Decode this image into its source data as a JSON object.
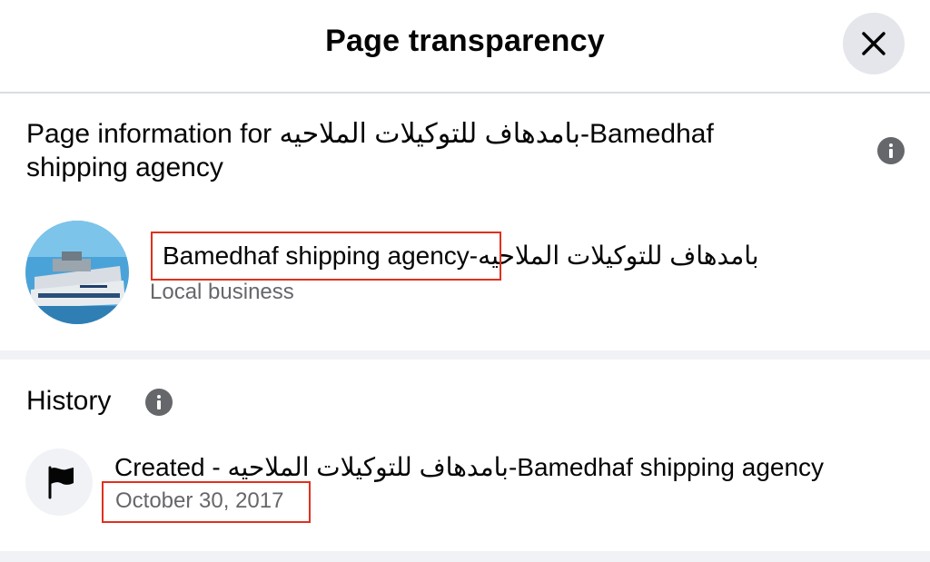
{
  "dialog": {
    "title": "Page transparency",
    "close_icon": "close-icon"
  },
  "page_info": {
    "title": "Page information for بامدهاف للتوكيلات الملاحيه-Bamedhaf shipping agency",
    "page_name": "بامدهاف للتوكيلات الملاحيه-Bamedhaf shipping agency",
    "page_name_latin": "Bamedhaf shipping agency-",
    "page_name_arabic": "بامدهاف للتوكيلات الملاحيه",
    "category": "Local business",
    "info_icon": "info-icon"
  },
  "history": {
    "title": "History",
    "info_icon": "info-icon",
    "entry_prefix": "Created - ",
    "entry_name": "بامدهاف للتوكيلات الملاحيه-Bamedhaf shipping agency",
    "date": "October 30, 2017",
    "flag_icon": "flag-icon"
  },
  "colors": {
    "highlight_border": "#e0301e",
    "secondary_text": "#65676b",
    "divider": "#f0f2f5",
    "button_bg": "#e4e6eb"
  }
}
